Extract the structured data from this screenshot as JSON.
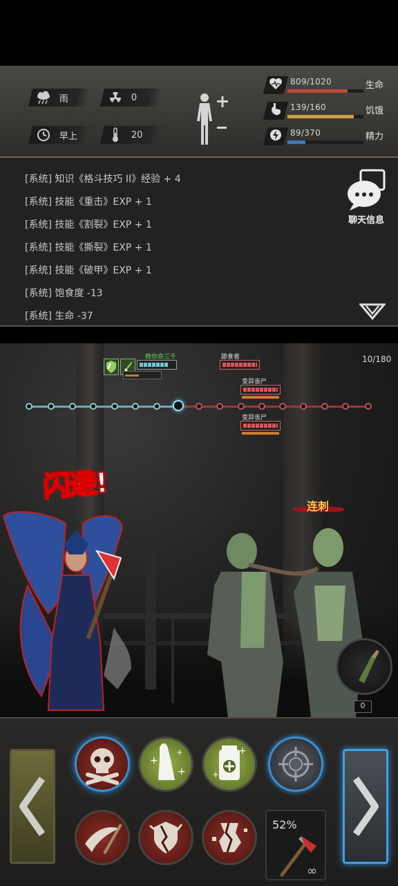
{
  "environment": {
    "weather": "雨",
    "radiation": "0",
    "time_of_day": "早上",
    "temperature": "20"
  },
  "stats": [
    {
      "name": "生命",
      "value_text": "809/1020",
      "current": 809,
      "max": 1020,
      "color": "#c2473a",
      "icon": "heart-icon"
    },
    {
      "name": "饥饿",
      "value_text": "139/160",
      "current": 139,
      "max": 160,
      "color": "#c9a046",
      "icon": "stomach-icon"
    },
    {
      "name": "精力",
      "value_text": "89/370",
      "current": 89,
      "max": 370,
      "color": "#3f78b8",
      "icon": "energy-icon"
    }
  ],
  "log": {
    "lines": [
      "[系统] 知识《格斗技巧 II》经验 + 4",
      "[系统] 技能《重击》EXP + 1",
      "[系统] 技能《割裂》EXP + 1",
      "[系统] 技能《撕裂》EXP + 1",
      "[系统] 技能《破甲》EXP + 1",
      "[系统] 饱食度 -13",
      "[系统] 生命 -37"
    ],
    "chat_label": "聊天信息"
  },
  "battle": {
    "turn_counter": "10/180",
    "player_name": "救你命三千",
    "enemies": [
      {
        "name": "舔食者"
      },
      {
        "name": "变异丧尸"
      },
      {
        "name": "变异丧尸"
      }
    ],
    "dodge_text": "闪避!",
    "skill_text": "连刺",
    "weapon_count": "0"
  },
  "controls": {
    "weapon_durability": "52%",
    "weapon_ammo": "∞",
    "skills": [
      {
        "icon": "skull-crossbones-icon"
      },
      {
        "icon": "body-heal-icon"
      },
      {
        "icon": "medkit-icon"
      },
      {
        "icon": "crosshair-icon"
      },
      {
        "icon": "slash-attack-icon"
      },
      {
        "icon": "shatter-armor-icon"
      },
      {
        "icon": "break-icon"
      }
    ]
  }
}
